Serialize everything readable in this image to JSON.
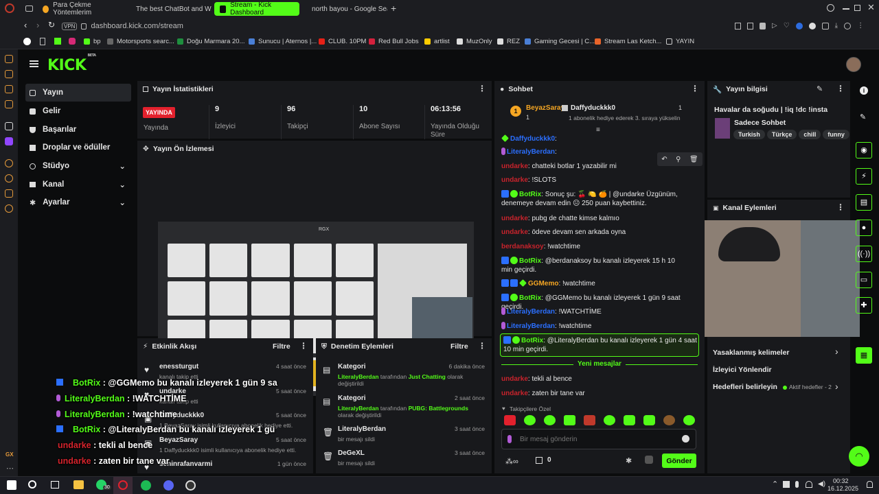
{
  "browser": {
    "tabs": [
      {
        "label": "Para Çekme Yöntemlerim"
      },
      {
        "label": "The best ChatBot and W..."
      },
      {
        "label": "Stream - Kick Dashboard"
      },
      {
        "label": "north bayou - Google Sea..."
      }
    ],
    "new_tab": "+",
    "vpn": "VPN",
    "url": "dashboard.kick.com/stream",
    "bookmarks": [
      "bp",
      "Motorsports searc...",
      "Doğu Marmara 20...",
      "Sunucu | Aternos |...",
      "CLUB. 10PM",
      "Red Bull Jobs",
      "artlist",
      "MuzOnly",
      "REZ",
      "Gaming Gecesi | C...",
      "Stream Las Ketch...",
      "YAYIN"
    ]
  },
  "logo": {
    "text": "KICK",
    "sup": "BETA"
  },
  "nav": [
    {
      "label": "Yayın",
      "icon": "broadcast-icon"
    },
    {
      "label": "Gelir",
      "icon": "revenue-icon"
    },
    {
      "label": "Başarılar",
      "icon": "trophy-icon"
    },
    {
      "label": "Droplar ve ödüller",
      "icon": "gift-icon"
    },
    {
      "label": "Stüdyo",
      "icon": "studio-icon"
    },
    {
      "label": "Kanal",
      "icon": "channel-icon"
    },
    {
      "label": "Ayarlar",
      "icon": "gear-icon"
    }
  ],
  "stats": {
    "title": "Yayın İstatistikleri",
    "live": "YAYINDA",
    "live_label": "Yayında",
    "items": [
      {
        "value": "9",
        "label": "İzleyici"
      },
      {
        "value": "96",
        "label": "Takipçi"
      },
      {
        "value": "10",
        "label": "Abone Sayısı"
      },
      {
        "value": "06:13:56",
        "label": "Yayında Olduğu Süre"
      }
    ]
  },
  "preview": {
    "title": "Yayın Ön İzlemesi",
    "rgx": "RGX",
    "nb": "NB"
  },
  "events": {
    "title": "Etkinlik Akışı",
    "filter": "Filtre",
    "items": [
      {
        "name": "enessturgut",
        "desc": "kanalı takip etti",
        "time": "4 saat önce"
      },
      {
        "name": "undarke",
        "desc": "kanalı takip etti",
        "time": "5 saat önce"
      },
      {
        "name": "Daffyduckkk0",
        "desc": "1 BeyazSaray isimli kullanıcıya abonelik hediye etti.",
        "time": "5 saat önce"
      },
      {
        "name": "BeyazSaray",
        "desc": "1 Daffyduckkk0 isimli kullanıcıya abonelik hediye etti.",
        "time": "5 saat önce"
      },
      {
        "name": "seninrafanvarmi",
        "desc": "",
        "time": "1 gün önce"
      }
    ]
  },
  "moderation": {
    "title": "Denetim Eylemleri",
    "filter": "Filtre",
    "items": [
      {
        "title": "Kategori",
        "actor": "LiteralyBerdan",
        "mid": "tarafından",
        "target": "Just Chatting",
        "end": "olarak değiştirildi",
        "time": "6 dakika önce"
      },
      {
        "title": "Kategori",
        "actor": "LiteralyBerdan",
        "mid": "tarafından",
        "target": "PUBG: Battlegrounds",
        "end": "olarak değiştirildi",
        "time": "2 saat önce"
      },
      {
        "title": "LiteralyBerdan",
        "actor": "",
        "mid": "",
        "target": "",
        "end": "bir mesajı sildi",
        "time": "3 saat önce"
      },
      {
        "title": "DeGeXL",
        "actor": "",
        "mid": "",
        "target": "",
        "end": "bir mesajı sildi",
        "time": "3 saat önce"
      }
    ]
  },
  "chat": {
    "title": "Sohbet",
    "pinned": {
      "user1": "BeyazSaray",
      "count1": "1",
      "user2": "Daffyduckkk0",
      "count2": "1",
      "note": "1 abonelik hediye ederek 3. sıraya yükselin"
    },
    "messages": [
      {
        "user": "Daffyduckkk0",
        "text": ":",
        "color": "u-blue"
      },
      {
        "user": "LiteralyBerdan",
        "text": ":",
        "color": "u-blue"
      },
      {
        "user": "undarke",
        "text": ": chatteki botlar 1 yazabilir mi",
        "color": "u-red"
      },
      {
        "user": "undarke",
        "text": ": !SLOTS",
        "color": "u-red"
      },
      {
        "user": "BotRix",
        "text": ": Sonuç şu: 🍒 🍋 🍊 | @undarke Üzgünüm, denemeye devam edin 😐 250 puan kaybettiniz.",
        "color": "u-green"
      },
      {
        "user": "undarke",
        "text": ": pubg de chatte kimse kalmıo",
        "color": "u-red"
      },
      {
        "user": "undarke",
        "text": ": ödeve devam sen arkada oyna",
        "color": "u-red"
      },
      {
        "user": "berdanaksoy",
        "text": ": !watchtime",
        "color": "u-red"
      },
      {
        "user": "BotRix",
        "text": ": @berdanaksoy bu kanalı izleyerek 15 h 10 min geçirdi.",
        "color": "u-green"
      },
      {
        "user": "GGMemo",
        "text": ": !watchtime",
        "color": "u-orange"
      },
      {
        "user": "BotRix",
        "text": ": @GGMemo bu kanalı izleyerek 1 gün 9 saat geçirdi.",
        "color": "u-green"
      },
      {
        "user": "LiteralyBerdan",
        "text": ": !WATCHTİME",
        "color": "u-blue"
      },
      {
        "user": "LiteralyBerdan",
        "text": ": !watchtime",
        "color": "u-blue"
      },
      {
        "user": "BotRix",
        "text": ": @LiteralyBerdan bu kanalı izleyerek 1 gün 4 saat 10 min geçirdi.",
        "color": "u-green"
      }
    ],
    "new_label": "Yeni mesajlar",
    "new_messages": [
      {
        "user": "undarke",
        "text": ": tekli al bence"
      },
      {
        "user": "undarke",
        "text": ": zaten bir tane var"
      }
    ],
    "follower_special": "Takipçilere Özel",
    "placeholder": "Bir mesaj gönderin",
    "points": "0",
    "send": "Gönder"
  },
  "overlay": [
    {
      "user": "BotRix",
      "text": " : @GGMemo bu kanalı izleyerek 1 gün 9 sa",
      "color": "#53fc18"
    },
    {
      "user": "LiteralyBerdan",
      "text": " : !WATCHTİME",
      "color": "#53fc18"
    },
    {
      "user": "LiteralyBerdan",
      "text": " : !watchtime",
      "color": "#53fc18"
    },
    {
      "user": "BotRix",
      "text": " : @LiteralyBerdan bu kanalı izleyerek 1 gü",
      "color": "#53fc18"
    },
    {
      "user": "undarke",
      "text": " : tekli al bence",
      "color": "#c8232c"
    },
    {
      "user": "undarke",
      "text": " : zaten bir tane var",
      "color": "#c8232c"
    }
  ],
  "streaminfo": {
    "title": "Yayın bilgisi",
    "stream_title": "Havalar da soğudu | !iq !dc !insta",
    "category": "Sadece Sohbet",
    "tags": [
      "Turkish",
      "Türkçe",
      "chill",
      "funny"
    ]
  },
  "channel_actions": {
    "title": "Kanal Eylemleri",
    "links": [
      "Yasaklanmış kelimeler",
      "İzleyici Yönlendir",
      "Hedefleri belirleyin"
    ],
    "goals_status": "Aktif hedefler - 2"
  },
  "taskbar": {
    "time": "00:32",
    "date": "16.12.2025",
    "badge": "30"
  },
  "colors": {
    "accent": "#53fc18",
    "bg": "#0b0c0d",
    "panel": "#18191c",
    "live": "#e3212d"
  }
}
